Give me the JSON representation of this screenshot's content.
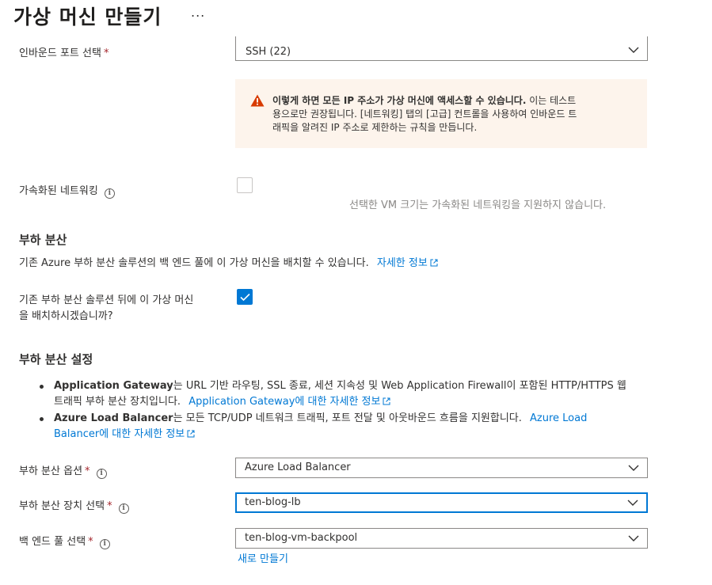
{
  "header": {
    "title": "가상 머신 만들기",
    "more": "..."
  },
  "inbound_ports": {
    "label": "인바운드 포트 선택",
    "required": "*",
    "value": "SSH (22)"
  },
  "warning": {
    "icon": "warning-icon",
    "bold": "이렇게 하면 모든 IP 주소가 가상 머신에 액세스할 수 있습니다.",
    "line1_rest": " 이는 테스트",
    "line2": "용으로만 권장됩니다. [네트워킹] 탭의 [고급] 컨트롤을 사용하여 인바운드 트",
    "line3": "래픽을 알려진 IP 주소로 제한하는 규칙을 만듭니다."
  },
  "accelerated": {
    "label": "가속화된 네트워킹",
    "checked": false,
    "note": "선택한 VM 크기는 가속화된 네트워킹을 지원하지 않습니다."
  },
  "load_balancing": {
    "title": "부하 분산",
    "description": "기존 Azure 부하 분산 솔루션의 백 엔드 풀에 이 가상 머신을 배치할 수 있습니다.",
    "learn_more": "자세한 정보",
    "question_line1": "기존 부하 분산 솔루션 뒤에 이 가상 머신",
    "question_line2": "을 배치하시겠습니까?",
    "checked": true
  },
  "lb_settings": {
    "title": "부하 분산 설정",
    "ag_name": "Application Gateway",
    "ag_text1": "는 URL 기반 라우팅, SSL 종료, 세션 지속성 및 Web Application Firewall이 포함된 HTTP/HTTPS 웹",
    "ag_text2": "트래픽 부하 분산 장치입니다.",
    "ag_link": "Application Gateway에 대한 자세한 정보",
    "alb_name": "Azure Load Balancer",
    "alb_text1": "는 모든 TCP/UDP 네트워크 트래픽, 포트 전달 및 아웃바운드 흐름을 지원합니다.",
    "alb_link1": "Azure Load",
    "alb_link2": "Balancer에 대한 자세한 정보"
  },
  "fields": {
    "lb_option": {
      "label": "부하 분산 옵션",
      "required": "*",
      "value": "Azure Load Balancer"
    },
    "lb_select": {
      "label": "부하 분산 장치 선택",
      "required": "*",
      "value": "ten-blog-lb"
    },
    "backend_pool": {
      "label": "백 엔드 풀 선택",
      "required": "*",
      "value": "ten-blog-vm-backpool"
    }
  },
  "create_new": "새로 만들기",
  "colors": {
    "accent": "#0078d4",
    "warning_bg": "#fdf4ec",
    "warning_icon": "#d83b01",
    "required": "#a4262c"
  }
}
